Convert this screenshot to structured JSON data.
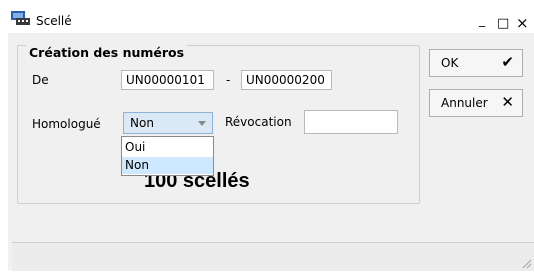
{
  "window": {
    "title": "Scellé"
  },
  "titlebar_buttons": {
    "minimize": "_",
    "maximize": "□",
    "close": "×"
  },
  "group": {
    "title": "Création des numéros",
    "de_label": "De",
    "from_value": "UN00000101",
    "separator": "-",
    "to_value": "UN00000200",
    "homologue_label": "Homologué",
    "homologue_value": "Non",
    "homologue_options": [
      "Oui",
      "Non"
    ],
    "revocation_label": "Révocation",
    "revocation_value": "",
    "count_text": "100 scellés"
  },
  "buttons": {
    "ok_label": "OK",
    "ok_icon": "checkmark-icon",
    "cancel_label": "Annuler",
    "cancel_icon": "cross-icon"
  },
  "colors": {
    "accent": "#dbe8f6",
    "selection": "#cde8ff"
  }
}
